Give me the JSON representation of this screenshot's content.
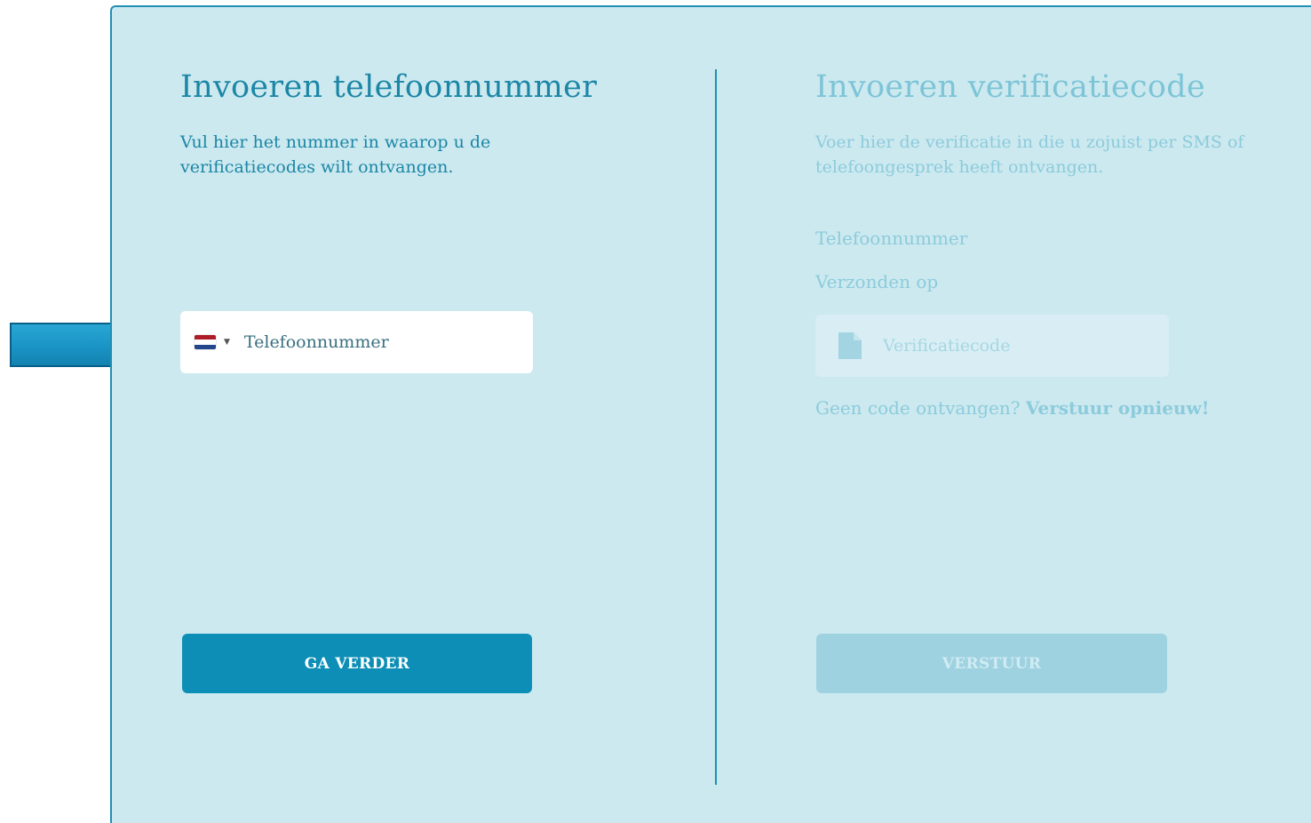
{
  "phone_step": {
    "title": "Invoeren telefoonnummer",
    "description": "Vul hier het nummer in waarop u de verificatiecodes wilt ontvangen.",
    "phone_input": {
      "placeholder": "Telefoonnummer",
      "value": ""
    },
    "country_flag_colors": [
      "#ae1c28",
      "#ffffff",
      "#21468b"
    ],
    "continue_button": "GA VERDER"
  },
  "verify_step": {
    "title": "Invoeren verificatiecode",
    "description": "Voer hier de verificatie in die u zojuist per SMS of telefoongesprek heeft ontvangen.",
    "phone_label": "Telefoonnummer",
    "sent_label": "Verzonden op",
    "code_input": {
      "placeholder": "Verificatiecode",
      "value": ""
    },
    "resend_prefix": "Geen code ontvangen? ",
    "resend_link": "Verstuur opnieuw!",
    "submit_button": "VERSTUUR"
  },
  "colors": {
    "panel": "#cce9ef",
    "accent": "#1c86a6",
    "button": "#0d8eb6",
    "disabled": "#9fd2e0"
  },
  "icons": [
    "dutch-flag-icon",
    "caret-down-icon",
    "document-icon",
    "arrow-right-icon"
  ]
}
